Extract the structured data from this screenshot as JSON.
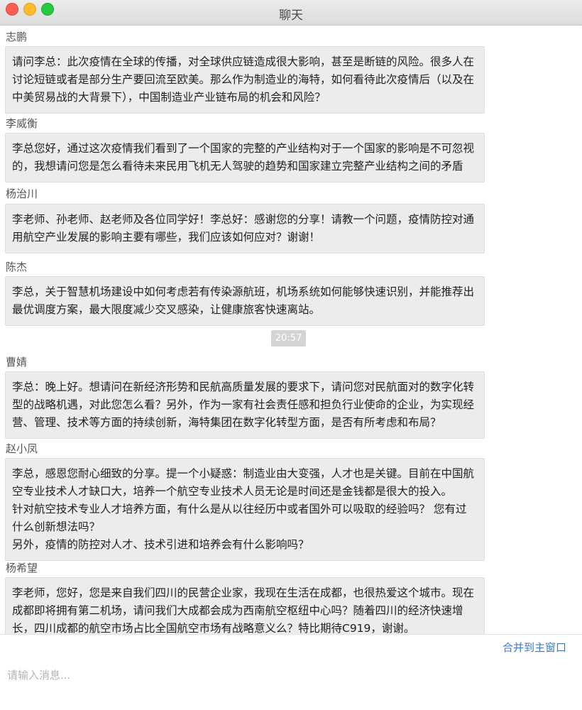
{
  "window": {
    "title": "聊天",
    "controls": [
      "close",
      "minimize",
      "maximize"
    ]
  },
  "messages": [
    {
      "sender": "志鹏",
      "text": "请问李总：此次疫情在全球的传播，对全球供应链造成很大影响，甚至是断链的风险。很多人在讨论短链或者是部分生产要回流至欧美。那么作为制造业的海特，如何看待此次疫情后（以及在中美贸易战的大背景下），中国制造业产业链布局的机会和风险？"
    },
    {
      "sender": "李威衡",
      "text": "李总您好，通过这次疫情我们看到了一个国家的完整的产业结构对于一个国家的影响是不可忽视的，我想请问您是怎么看待未来民用飞机无人驾驶的趋势和国家建立完整产业结构之间的矛盾"
    },
    {
      "sender": "杨治川",
      "text": "李老师、孙老师、赵老师及各位同学好！李总好：感谢您的分享！请教一个问题，疫情防控对通用航空产业发展的影响主要有哪些，我们应该如何应对？谢谢！"
    },
    {
      "sender": "陈杰",
      "text": "李总，关于智慧机场建设中如何考虑若有传染源航班，机场系统如何能够快速识别，并能推荐出最优调度方案，最大限度减少交叉感染，让健康旅客快速离站。"
    },
    {
      "sender": "曹婧",
      "text": "李总：晚上好。想请问在新经济形势和民航高质量发展的要求下，请问您对民航面对的数字化转型的战略机遇，对此您怎么看？另外，作为一家有社会责任感和担负行业使命的企业，为实现经营、管理、技术等方面的持续创新，海特集团在数字化转型方面，是否有所考虑和布局？"
    },
    {
      "sender": "赵小凤",
      "text": "李总，感恩您耐心细致的分享。提一个小疑惑：制造业由大变强，人才也是关键。目前在中国航空专业技术人才缺口大，培养一个航空专业技术人员无论是时间还是金钱都是很大的投入。\n针对航空技术专业人才培养方面，有什么是从以往经历中或者国外可以吸取的经验吗？ 您有过什么创新想法吗？\n另外，疫情的防控对人才、技术引进和培养会有什么影响吗？"
    },
    {
      "sender": "杨希望",
      "text": "李老师，您好，您是来自我们四川的民营企业家，我现在生活在成都，也很热爱这个城市。现在成都即将拥有第二机场，请问我们大成都会成为西南航空枢纽中心吗？随着四川的经济快速增长，四川成都的航空市场占比全国航空市场有战略意义么？特比期待C919，谢谢。"
    }
  ],
  "timestamp": "20:57",
  "merge_link": "合并到主窗口",
  "input": {
    "placeholder": "请输入消息...",
    "value": ""
  },
  "colors": {
    "bubble": "#ececec",
    "link": "#3d7bc9",
    "close": "#fd5f57",
    "minimize": "#fdbc2e",
    "maximize": "#28c840"
  }
}
